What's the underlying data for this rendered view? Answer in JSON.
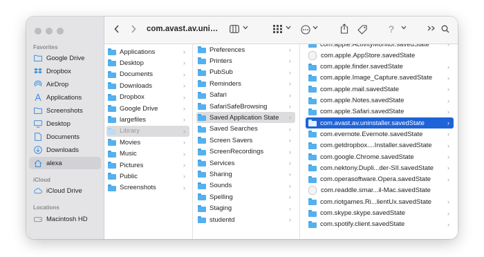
{
  "colors": {
    "accent": "#1f63d8",
    "sidebar_bg": "#e4e4e6",
    "folder": "#55b0ee"
  },
  "toolbar": {
    "title": "com.avast.av.uninstaller.savedState",
    "icons": [
      "back-icon",
      "forward-icon",
      "column-view-icon",
      "chevron-down-icon",
      "group-icon",
      "more-icon",
      "share-icon",
      "tag-icon",
      "help-icon",
      "extend-icon",
      "search-icon"
    ]
  },
  "sidebar": {
    "favorites_header": "Favorites",
    "favorites": [
      {
        "label": "Google Drive",
        "icon": "folder-icon"
      },
      {
        "label": "Dropbox",
        "icon": "dropbox-icon"
      },
      {
        "label": "AirDrop",
        "icon": "airdrop-icon"
      },
      {
        "label": "Applications",
        "icon": "applications-icon"
      },
      {
        "label": "Screenshots",
        "icon": "folder-icon"
      },
      {
        "label": "Desktop",
        "icon": "desktop-icon"
      },
      {
        "label": "Documents",
        "icon": "document-icon"
      },
      {
        "label": "Downloads",
        "icon": "download-icon"
      },
      {
        "label": "alexa",
        "icon": "home-icon"
      }
    ],
    "icloud_header": "iCloud",
    "icloud": [
      {
        "label": "iCloud Drive",
        "icon": "cloud-icon"
      }
    ],
    "locations_header": "Locations",
    "locations": [
      {
        "label": "Macintosh HD",
        "icon": "disk-icon"
      }
    ]
  },
  "columns": {
    "col1": [
      "Applications",
      "Desktop",
      "Documents",
      "Downloads",
      "Dropbox",
      "Google Drive",
      "largefiles",
      "Library",
      "Movies",
      "Music",
      "Pictures",
      "Public",
      "Screenshots"
    ],
    "col2": [
      "Preferences",
      "Printers",
      "PubSub",
      "Reminders",
      "Safari",
      "SafariSafeBrowsing",
      "Saved Application State",
      "Saved Searches",
      "Screen Savers",
      "ScreenRecordings",
      "Services",
      "Sharing",
      "Sounds",
      "Spelling",
      "Staging",
      "studentd"
    ],
    "col3": [
      "com.apple.ActivityMonitor.savedState",
      "com.apple.AppStore.savedState",
      "com.apple.finder.savedState",
      "com.apple.Image_Capture.savedState",
      "com.apple.mail.savedState",
      "com.apple.Notes.savedState",
      "com.apple.Safari.savedState",
      "com.avast.av.uninstaller.savedState",
      "com.evernote.Evernote.savedState",
      "com.getdropbox....Installer.savedState",
      "com.google.Chrome.savedState",
      "com.nektony.Dupli...der-SII.savedState",
      "com.operasoftware.Opera.savedState",
      "com.readdle.smar...il-Mac.savedState",
      "com.riotgames.Ri...lientUx.savedState",
      "com.skype.skype.savedState",
      "com.spotify.client.savedState"
    ]
  }
}
